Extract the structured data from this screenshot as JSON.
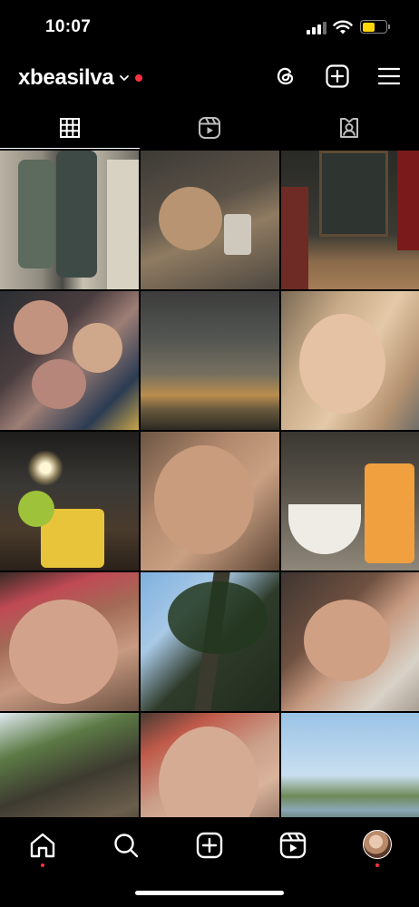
{
  "status_bar": {
    "time": "10:07",
    "battery_level": 0.55
  },
  "header": {
    "username": "xbeasilva",
    "icons": [
      "threads-icon",
      "create-plus-icon",
      "menu-hamburger-icon"
    ]
  },
  "tabs": [
    {
      "icon": "grid-icon",
      "active": true
    },
    {
      "icon": "reels-icon",
      "active": false
    },
    {
      "icon": "tagged-icon",
      "active": false
    }
  ],
  "posts": [
    {
      "name": "post-friends-outfit"
    },
    {
      "name": "post-mirror-selfie"
    },
    {
      "name": "post-chalkboard-menu"
    },
    {
      "name": "post-group-selfie"
    },
    {
      "name": "post-sunset-clouds"
    },
    {
      "name": "post-selfie-blonde"
    },
    {
      "name": "post-drink-sparkler"
    },
    {
      "name": "post-selfie-closeup"
    },
    {
      "name": "post-juice-dessert"
    },
    {
      "name": "post-selfie-red-hair"
    },
    {
      "name": "post-tree-sky"
    },
    {
      "name": "post-selfie-lying"
    },
    {
      "name": "post-tree-trunk"
    },
    {
      "name": "post-selfie-red-makeup"
    },
    {
      "name": "post-lake-landscape"
    }
  ],
  "bottom_nav": [
    "home-icon",
    "search-icon",
    "create-icon",
    "reels-icon",
    "profile-avatar"
  ],
  "colors": {
    "background": "#000000",
    "notification": "#ff3040",
    "battery": "#ffd60a"
  }
}
